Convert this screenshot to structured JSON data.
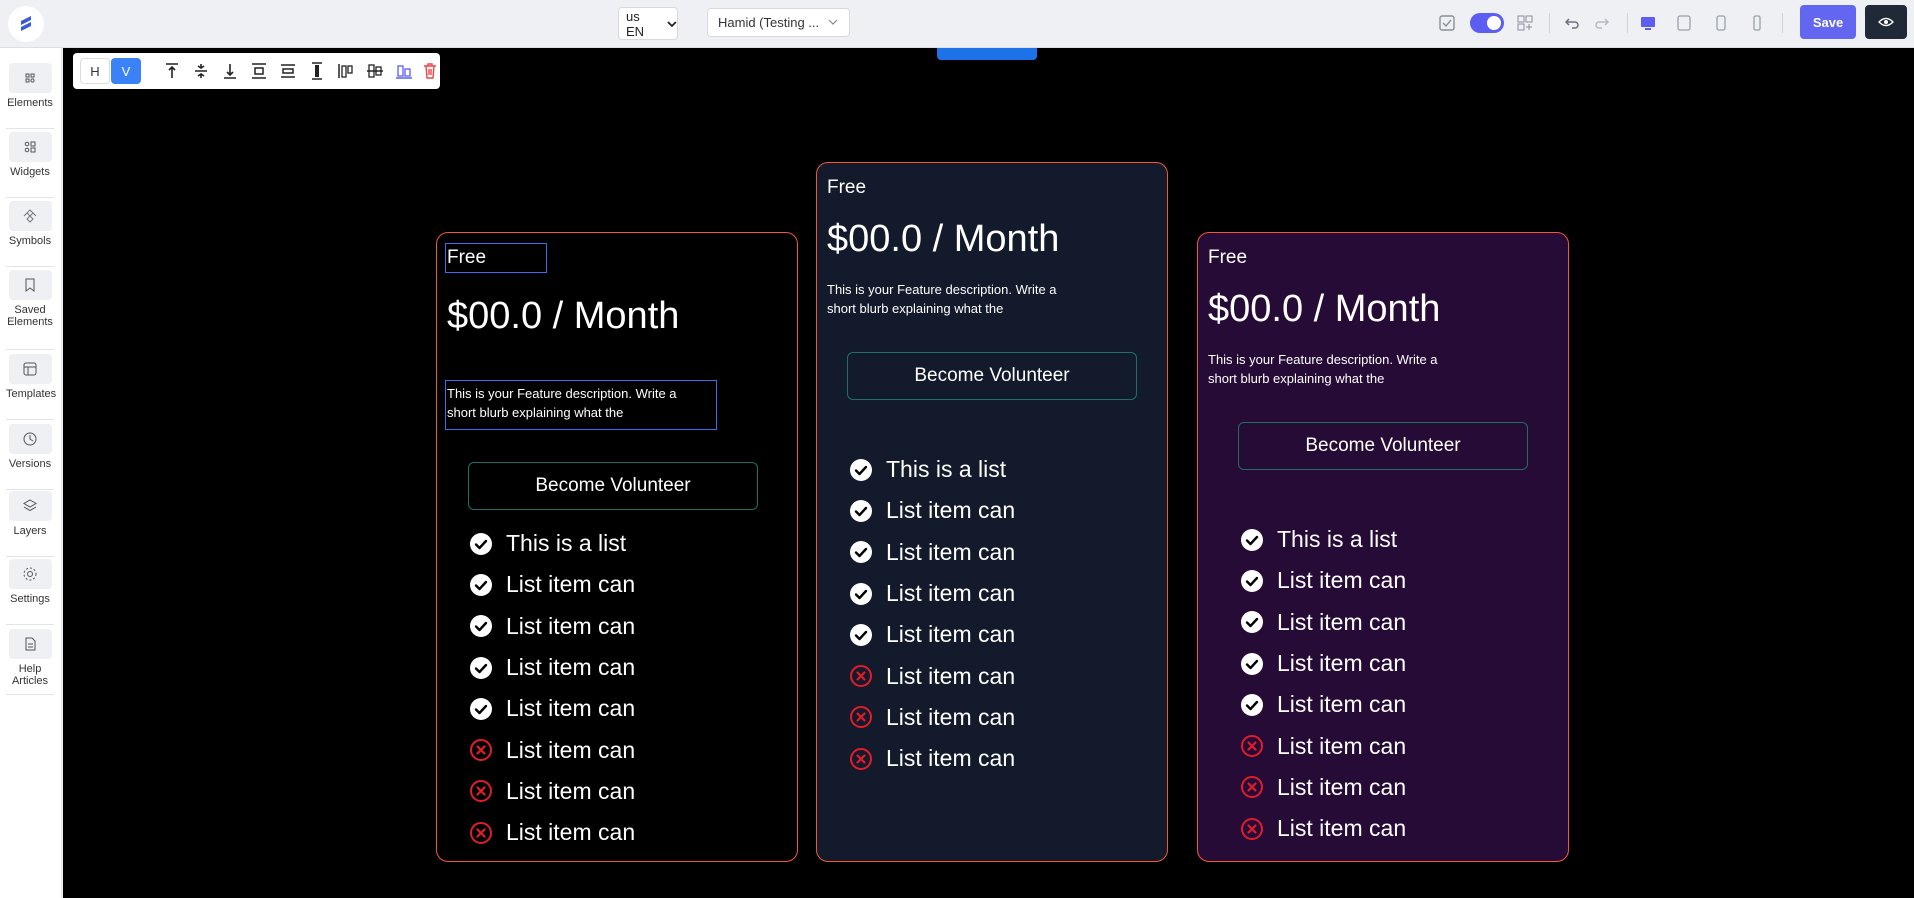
{
  "topbar": {
    "language": "us EN",
    "project": "Hamid (Testing ...",
    "save_label": "Save",
    "colors": {
      "accent": "#6366f1",
      "toggle": "#5b5ef0",
      "dark": "#1f2937"
    }
  },
  "toolbar": {
    "h_label": "H",
    "v_label": "V"
  },
  "sidebar": {
    "items": [
      {
        "label": "Elements",
        "icon": "elements-icon"
      },
      {
        "label": "Widgets",
        "icon": "widgets-icon"
      },
      {
        "label": "Symbols",
        "icon": "symbols-icon"
      },
      {
        "label": "Saved Elements",
        "icon": "saved-elements-icon"
      },
      {
        "label": "Templates",
        "icon": "templates-icon"
      },
      {
        "label": "Versions",
        "icon": "versions-icon"
      },
      {
        "label": "Layers",
        "icon": "layers-icon"
      },
      {
        "label": "Settings",
        "icon": "settings-icon"
      },
      {
        "label": "Help Articles",
        "icon": "help-articles-icon"
      }
    ]
  },
  "cards": [
    {
      "tier": "Free",
      "price": "$00.0 / Month",
      "description": "This is your Feature description. Write a short blurb explaining what the",
      "cta": "Become Volunteer",
      "background": "#000000",
      "features": [
        {
          "text": "This is a list",
          "included": true
        },
        {
          "text": "List item can",
          "included": true
        },
        {
          "text": "List item can",
          "included": true
        },
        {
          "text": "List item can",
          "included": true
        },
        {
          "text": "List item can",
          "included": true
        },
        {
          "text": "List item can",
          "included": false
        },
        {
          "text": "List item can",
          "included": false
        },
        {
          "text": "List item can",
          "included": false
        }
      ]
    },
    {
      "tier": "Free",
      "price": "$00.0 / Month",
      "description": "This is your Feature description. Write a short blurb explaining what the",
      "cta": "Become Volunteer",
      "background": "#131a2b",
      "features": [
        {
          "text": "This is a list",
          "included": true
        },
        {
          "text": "List item can",
          "included": true
        },
        {
          "text": "List item can",
          "included": true
        },
        {
          "text": "List item can",
          "included": true
        },
        {
          "text": "List item can",
          "included": true
        },
        {
          "text": "List item can",
          "included": false
        },
        {
          "text": "List item can",
          "included": false
        },
        {
          "text": "List item can",
          "included": false
        }
      ]
    },
    {
      "tier": "Free",
      "price": "$00.0 / Month",
      "description": "This is your Feature description. Write a short blurb explaining what the",
      "cta": "Become Volunteer",
      "background": "#250b36",
      "features": [
        {
          "text": "This is a list",
          "included": true
        },
        {
          "text": "List item can",
          "included": true
        },
        {
          "text": "List item can",
          "included": true
        },
        {
          "text": "List item can",
          "included": true
        },
        {
          "text": "List item can",
          "included": true
        },
        {
          "text": "List item can",
          "included": false
        },
        {
          "text": "List item can",
          "included": false
        },
        {
          "text": "List item can",
          "included": false
        }
      ]
    }
  ]
}
